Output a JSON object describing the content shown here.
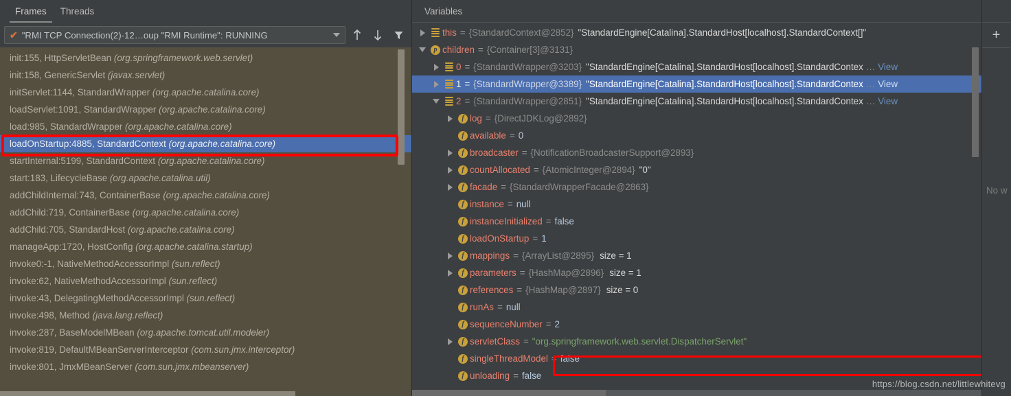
{
  "accent_color": "#4a88c7",
  "selection_color": "#4b6eaf",
  "highlight_color": "#ff0000",
  "frames": {
    "tabs": [
      {
        "label": "Frames",
        "active": true
      },
      {
        "label": "Threads",
        "active": false
      }
    ],
    "thread_selector": {
      "check_glyph": "✔",
      "value": "\"RMI TCP Connection(2)-12…oup \"RMI Runtime\": RUNNING",
      "dropdown_icon": "chevron-down-icon"
    },
    "toolbar_icons": [
      {
        "name": "arrow-up-icon",
        "title": "Up"
      },
      {
        "name": "arrow-down-icon",
        "title": "Down"
      },
      {
        "name": "filter-icon",
        "title": "Filter"
      }
    ],
    "rows": [
      {
        "method": "init:155, HttpServletBean ",
        "pkg": "(org.springframework.web.servlet)",
        "selected": false
      },
      {
        "method": "init:158, GenericServlet ",
        "pkg": "(javax.servlet)",
        "selected": false
      },
      {
        "method": "initServlet:1144, StandardWrapper ",
        "pkg": "(org.apache.catalina.core)",
        "selected": false
      },
      {
        "method": "loadServlet:1091, StandardWrapper ",
        "pkg": "(org.apache.catalina.core)",
        "selected": false
      },
      {
        "method": "load:985, StandardWrapper ",
        "pkg": "(org.apache.catalina.core)",
        "selected": false
      },
      {
        "method": "loadOnStartup:4885, StandardContext ",
        "pkg": "(org.apache.catalina.core)",
        "selected": true
      },
      {
        "method": "startInternal:5199, StandardContext ",
        "pkg": "(org.apache.catalina.core)",
        "selected": false
      },
      {
        "method": "start:183, LifecycleBase ",
        "pkg": "(org.apache.catalina.util)",
        "selected": false
      },
      {
        "method": "addChildInternal:743, ContainerBase ",
        "pkg": "(org.apache.catalina.core)",
        "selected": false
      },
      {
        "method": "addChild:719, ContainerBase ",
        "pkg": "(org.apache.catalina.core)",
        "selected": false
      },
      {
        "method": "addChild:705, StandardHost ",
        "pkg": "(org.apache.catalina.core)",
        "selected": false
      },
      {
        "method": "manageApp:1720, HostConfig ",
        "pkg": "(org.apache.catalina.startup)",
        "selected": false
      },
      {
        "method": "invoke0:-1, NativeMethodAccessorImpl ",
        "pkg": "(sun.reflect)",
        "selected": false
      },
      {
        "method": "invoke:62, NativeMethodAccessorImpl ",
        "pkg": "(sun.reflect)",
        "selected": false
      },
      {
        "method": "invoke:43, DelegatingMethodAccessorImpl ",
        "pkg": "(sun.reflect)",
        "selected": false
      },
      {
        "method": "invoke:498, Method ",
        "pkg": "(java.lang.reflect)",
        "selected": false
      },
      {
        "method": "invoke:287, BaseModelMBean ",
        "pkg": "(org.apache.tomcat.util.modeler)",
        "selected": false
      },
      {
        "method": "invoke:819, DefaultMBeanServerInterceptor ",
        "pkg": "(com.sun.jmx.interceptor)",
        "selected": false
      },
      {
        "method": "invoke:801, JmxMBeanServer ",
        "pkg": "(com.sun.jmx.mbeanserver)",
        "selected": false
      }
    ]
  },
  "variables": {
    "title": "Variables",
    "rows": [
      {
        "indent": 0,
        "twisty": "right",
        "icon": "object-stack-icon",
        "name": "this",
        "eq": "=",
        "type": "{StandardContext@2852}",
        "str": "\"StandardEngine[Catalina].StandardHost[localhost].StandardContext[]\"",
        "selected": false
      },
      {
        "indent": 0,
        "twisty": "down",
        "icon": "property-icon",
        "iconLetter": "p",
        "name": "children",
        "eq": "=",
        "type": "{Container[3]@3131}",
        "str": "",
        "selected": false
      },
      {
        "indent": 1,
        "twisty": "right",
        "icon": "object-stack-icon",
        "name": "0",
        "eq": "=",
        "type": "{StandardWrapper@3203}",
        "str": "\"StandardEngine[Catalina].StandardHost[localhost].StandardContex",
        "ellipsis": "…",
        "view": "View",
        "selected": false
      },
      {
        "indent": 1,
        "twisty": "right",
        "icon": "object-stack-icon",
        "name": "1",
        "eq": "=",
        "type": "{StandardWrapper@3389}",
        "str": "\"StandardEngine[Catalina].StandardHost[localhost].StandardContex",
        "ellipsis": "…",
        "view": "View",
        "selected": true
      },
      {
        "indent": 1,
        "twisty": "down",
        "icon": "object-stack-icon",
        "name": "2",
        "eq": "=",
        "type": "{StandardWrapper@2851}",
        "str": "\"StandardEngine[Catalina].StandardHost[localhost].StandardContex",
        "ellipsis": "…",
        "view": "View",
        "selected": false
      },
      {
        "indent": 2,
        "twisty": "right",
        "icon": "field-icon",
        "iconLetter": "f",
        "name": "log",
        "eq": "=",
        "type": "{DirectJDKLog@2892}",
        "str": "",
        "selected": false
      },
      {
        "indent": 2,
        "twisty": "none",
        "icon": "field-icon",
        "iconLetter": "f",
        "name": "available",
        "eq": "=",
        "num": "0",
        "selected": false
      },
      {
        "indent": 2,
        "twisty": "right",
        "icon": "field-icon",
        "iconLetter": "f",
        "name": "broadcaster",
        "eq": "=",
        "type": "{NotificationBroadcasterSupport@2893}",
        "str": "",
        "selected": false
      },
      {
        "indent": 2,
        "twisty": "right",
        "icon": "field-icon",
        "iconLetter": "f",
        "name": "countAllocated",
        "eq": "=",
        "type": "{AtomicInteger@2894}",
        "str": "\"0\"",
        "selected": false
      },
      {
        "indent": 2,
        "twisty": "right",
        "icon": "field-icon",
        "iconLetter": "f",
        "name": "facade",
        "eq": "=",
        "type": "{StandardWrapperFacade@2863}",
        "str": "",
        "selected": false
      },
      {
        "indent": 2,
        "twisty": "none",
        "icon": "field-icon",
        "iconLetter": "f",
        "name": "instance",
        "eq": "=",
        "nullv": "null",
        "selected": false
      },
      {
        "indent": 2,
        "twisty": "none",
        "icon": "field-icon",
        "iconLetter": "f",
        "name": "instanceInitialized",
        "eq": "=",
        "bool": "false",
        "selected": false
      },
      {
        "indent": 2,
        "twisty": "none",
        "icon": "field-icon",
        "iconLetter": "f",
        "name": "loadOnStartup",
        "eq": "=",
        "num": "1",
        "selected": false
      },
      {
        "indent": 2,
        "twisty": "right",
        "icon": "field-icon",
        "iconLetter": "f",
        "name": "mappings",
        "eq": "=",
        "type": "{ArrayList@2895}",
        "size": "size = 1",
        "selected": false
      },
      {
        "indent": 2,
        "twisty": "right",
        "icon": "field-icon",
        "iconLetter": "f",
        "name": "parameters",
        "eq": "=",
        "type": "{HashMap@2896}",
        "size": "size = 1",
        "selected": false
      },
      {
        "indent": 2,
        "twisty": "none",
        "icon": "field-icon",
        "iconLetter": "f",
        "name": "references",
        "eq": "=",
        "type": "{HashMap@2897}",
        "size": "size = 0",
        "selected": false
      },
      {
        "indent": 2,
        "twisty": "none",
        "icon": "field-icon",
        "iconLetter": "f",
        "name": "runAs",
        "eq": "=",
        "nullv": "null",
        "selected": false
      },
      {
        "indent": 2,
        "twisty": "none",
        "icon": "field-icon",
        "iconLetter": "f",
        "name": "sequenceNumber",
        "eq": "=",
        "num": "2",
        "selected": false
      },
      {
        "indent": 2,
        "twisty": "right",
        "icon": "field-icon",
        "iconLetter": "f",
        "name": "servletClass",
        "eq": "=",
        "green": "\"org.springframework.web.servlet.DispatcherServlet\"",
        "selected": false
      },
      {
        "indent": 2,
        "twisty": "none",
        "icon": "field-icon",
        "iconLetter": "f",
        "name": "singleThreadModel",
        "eq": "=",
        "bool": "false",
        "selected": false
      },
      {
        "indent": 2,
        "twisty": "none",
        "icon": "field-icon",
        "iconLetter": "f",
        "name": "unloading",
        "eq": "=",
        "bool": "false",
        "selected": false
      }
    ]
  },
  "watches": {
    "add_label": "+",
    "empty_text": "No w"
  },
  "watermark": "https://blog.csdn.net/littlewhitevg"
}
